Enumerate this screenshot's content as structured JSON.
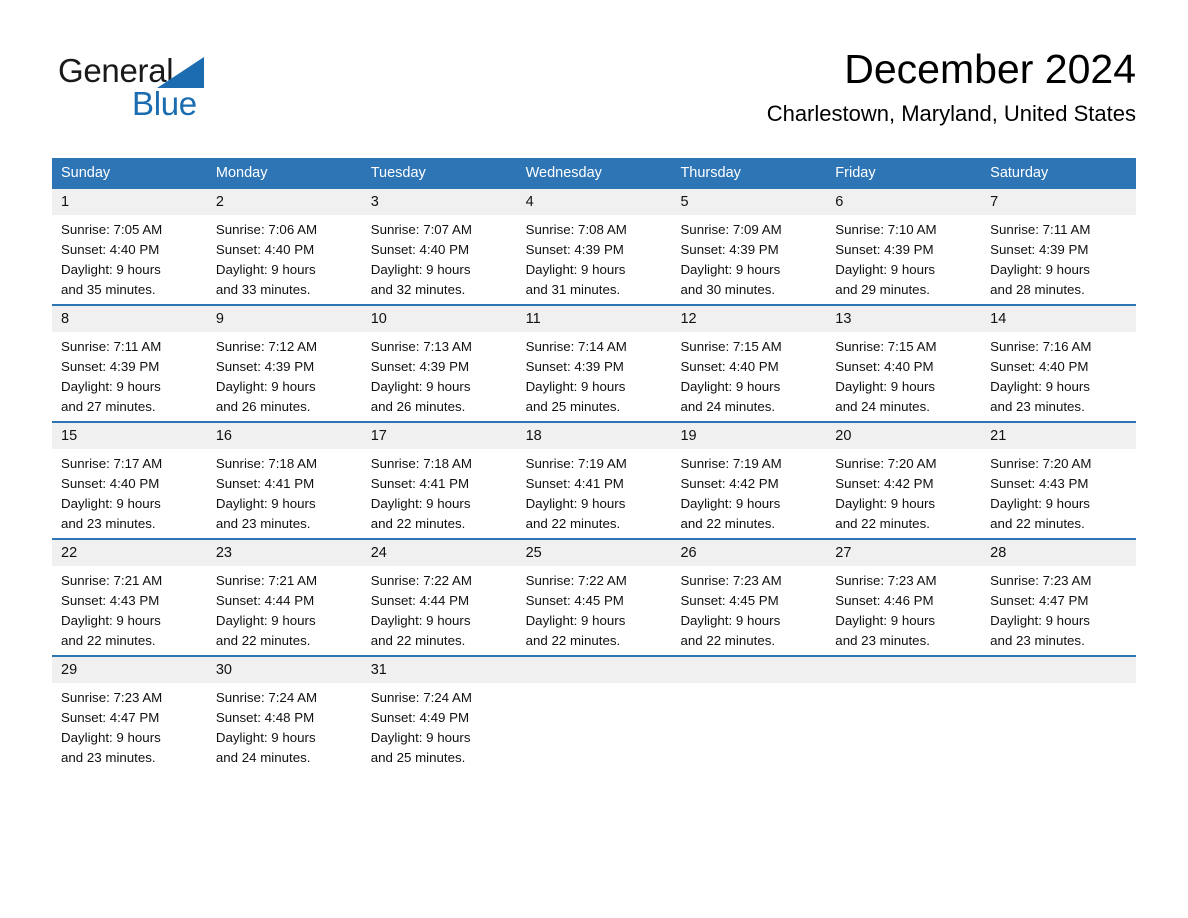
{
  "brand": {
    "name_part1": "General",
    "name_part2": "Blue",
    "triangle_color": "#1b6cb0"
  },
  "header": {
    "month_title": "December 2024",
    "location": "Charlestown, Maryland, United States"
  },
  "calendar": {
    "accent_color": "#2E75B6",
    "daynum_band_color": "#f0f0f0",
    "day_headers": [
      "Sunday",
      "Monday",
      "Tuesday",
      "Wednesday",
      "Thursday",
      "Friday",
      "Saturday"
    ],
    "weeks": [
      [
        {
          "day": "1",
          "sunrise": "Sunrise: 7:05 AM",
          "sunset": "Sunset: 4:40 PM",
          "daylight_line1": "Daylight: 9 hours",
          "daylight_line2": "and 35 minutes."
        },
        {
          "day": "2",
          "sunrise": "Sunrise: 7:06 AM",
          "sunset": "Sunset: 4:40 PM",
          "daylight_line1": "Daylight: 9 hours",
          "daylight_line2": "and 33 minutes."
        },
        {
          "day": "3",
          "sunrise": "Sunrise: 7:07 AM",
          "sunset": "Sunset: 4:40 PM",
          "daylight_line1": "Daylight: 9 hours",
          "daylight_line2": "and 32 minutes."
        },
        {
          "day": "4",
          "sunrise": "Sunrise: 7:08 AM",
          "sunset": "Sunset: 4:39 PM",
          "daylight_line1": "Daylight: 9 hours",
          "daylight_line2": "and 31 minutes."
        },
        {
          "day": "5",
          "sunrise": "Sunrise: 7:09 AM",
          "sunset": "Sunset: 4:39 PM",
          "daylight_line1": "Daylight: 9 hours",
          "daylight_line2": "and 30 minutes."
        },
        {
          "day": "6",
          "sunrise": "Sunrise: 7:10 AM",
          "sunset": "Sunset: 4:39 PM",
          "daylight_line1": "Daylight: 9 hours",
          "daylight_line2": "and 29 minutes."
        },
        {
          "day": "7",
          "sunrise": "Sunrise: 7:11 AM",
          "sunset": "Sunset: 4:39 PM",
          "daylight_line1": "Daylight: 9 hours",
          "daylight_line2": "and 28 minutes."
        }
      ],
      [
        {
          "day": "8",
          "sunrise": "Sunrise: 7:11 AM",
          "sunset": "Sunset: 4:39 PM",
          "daylight_line1": "Daylight: 9 hours",
          "daylight_line2": "and 27 minutes."
        },
        {
          "day": "9",
          "sunrise": "Sunrise: 7:12 AM",
          "sunset": "Sunset: 4:39 PM",
          "daylight_line1": "Daylight: 9 hours",
          "daylight_line2": "and 26 minutes."
        },
        {
          "day": "10",
          "sunrise": "Sunrise: 7:13 AM",
          "sunset": "Sunset: 4:39 PM",
          "daylight_line1": "Daylight: 9 hours",
          "daylight_line2": "and 26 minutes."
        },
        {
          "day": "11",
          "sunrise": "Sunrise: 7:14 AM",
          "sunset": "Sunset: 4:39 PM",
          "daylight_line1": "Daylight: 9 hours",
          "daylight_line2": "and 25 minutes."
        },
        {
          "day": "12",
          "sunrise": "Sunrise: 7:15 AM",
          "sunset": "Sunset: 4:40 PM",
          "daylight_line1": "Daylight: 9 hours",
          "daylight_line2": "and 24 minutes."
        },
        {
          "day": "13",
          "sunrise": "Sunrise: 7:15 AM",
          "sunset": "Sunset: 4:40 PM",
          "daylight_line1": "Daylight: 9 hours",
          "daylight_line2": "and 24 minutes."
        },
        {
          "day": "14",
          "sunrise": "Sunrise: 7:16 AM",
          "sunset": "Sunset: 4:40 PM",
          "daylight_line1": "Daylight: 9 hours",
          "daylight_line2": "and 23 minutes."
        }
      ],
      [
        {
          "day": "15",
          "sunrise": "Sunrise: 7:17 AM",
          "sunset": "Sunset: 4:40 PM",
          "daylight_line1": "Daylight: 9 hours",
          "daylight_line2": "and 23 minutes."
        },
        {
          "day": "16",
          "sunrise": "Sunrise: 7:18 AM",
          "sunset": "Sunset: 4:41 PM",
          "daylight_line1": "Daylight: 9 hours",
          "daylight_line2": "and 23 minutes."
        },
        {
          "day": "17",
          "sunrise": "Sunrise: 7:18 AM",
          "sunset": "Sunset: 4:41 PM",
          "daylight_line1": "Daylight: 9 hours",
          "daylight_line2": "and 22 minutes."
        },
        {
          "day": "18",
          "sunrise": "Sunrise: 7:19 AM",
          "sunset": "Sunset: 4:41 PM",
          "daylight_line1": "Daylight: 9 hours",
          "daylight_line2": "and 22 minutes."
        },
        {
          "day": "19",
          "sunrise": "Sunrise: 7:19 AM",
          "sunset": "Sunset: 4:42 PM",
          "daylight_line1": "Daylight: 9 hours",
          "daylight_line2": "and 22 minutes."
        },
        {
          "day": "20",
          "sunrise": "Sunrise: 7:20 AM",
          "sunset": "Sunset: 4:42 PM",
          "daylight_line1": "Daylight: 9 hours",
          "daylight_line2": "and 22 minutes."
        },
        {
          "day": "21",
          "sunrise": "Sunrise: 7:20 AM",
          "sunset": "Sunset: 4:43 PM",
          "daylight_line1": "Daylight: 9 hours",
          "daylight_line2": "and 22 minutes."
        }
      ],
      [
        {
          "day": "22",
          "sunrise": "Sunrise: 7:21 AM",
          "sunset": "Sunset: 4:43 PM",
          "daylight_line1": "Daylight: 9 hours",
          "daylight_line2": "and 22 minutes."
        },
        {
          "day": "23",
          "sunrise": "Sunrise: 7:21 AM",
          "sunset": "Sunset: 4:44 PM",
          "daylight_line1": "Daylight: 9 hours",
          "daylight_line2": "and 22 minutes."
        },
        {
          "day": "24",
          "sunrise": "Sunrise: 7:22 AM",
          "sunset": "Sunset: 4:44 PM",
          "daylight_line1": "Daylight: 9 hours",
          "daylight_line2": "and 22 minutes."
        },
        {
          "day": "25",
          "sunrise": "Sunrise: 7:22 AM",
          "sunset": "Sunset: 4:45 PM",
          "daylight_line1": "Daylight: 9 hours",
          "daylight_line2": "and 22 minutes."
        },
        {
          "day": "26",
          "sunrise": "Sunrise: 7:23 AM",
          "sunset": "Sunset: 4:45 PM",
          "daylight_line1": "Daylight: 9 hours",
          "daylight_line2": "and 22 minutes."
        },
        {
          "day": "27",
          "sunrise": "Sunrise: 7:23 AM",
          "sunset": "Sunset: 4:46 PM",
          "daylight_line1": "Daylight: 9 hours",
          "daylight_line2": "and 23 minutes."
        },
        {
          "day": "28",
          "sunrise": "Sunrise: 7:23 AM",
          "sunset": "Sunset: 4:47 PM",
          "daylight_line1": "Daylight: 9 hours",
          "daylight_line2": "and 23 minutes."
        }
      ],
      [
        {
          "day": "29",
          "sunrise": "Sunrise: 7:23 AM",
          "sunset": "Sunset: 4:47 PM",
          "daylight_line1": "Daylight: 9 hours",
          "daylight_line2": "and 23 minutes."
        },
        {
          "day": "30",
          "sunrise": "Sunrise: 7:24 AM",
          "sunset": "Sunset: 4:48 PM",
          "daylight_line1": "Daylight: 9 hours",
          "daylight_line2": "and 24 minutes."
        },
        {
          "day": "31",
          "sunrise": "Sunrise: 7:24 AM",
          "sunset": "Sunset: 4:49 PM",
          "daylight_line1": "Daylight: 9 hours",
          "daylight_line2": "and 25 minutes."
        },
        {
          "day": "",
          "sunrise": "",
          "sunset": "",
          "daylight_line1": "",
          "daylight_line2": ""
        },
        {
          "day": "",
          "sunrise": "",
          "sunset": "",
          "daylight_line1": "",
          "daylight_line2": ""
        },
        {
          "day": "",
          "sunrise": "",
          "sunset": "",
          "daylight_line1": "",
          "daylight_line2": ""
        },
        {
          "day": "",
          "sunrise": "",
          "sunset": "",
          "daylight_line1": "",
          "daylight_line2": ""
        }
      ]
    ]
  }
}
